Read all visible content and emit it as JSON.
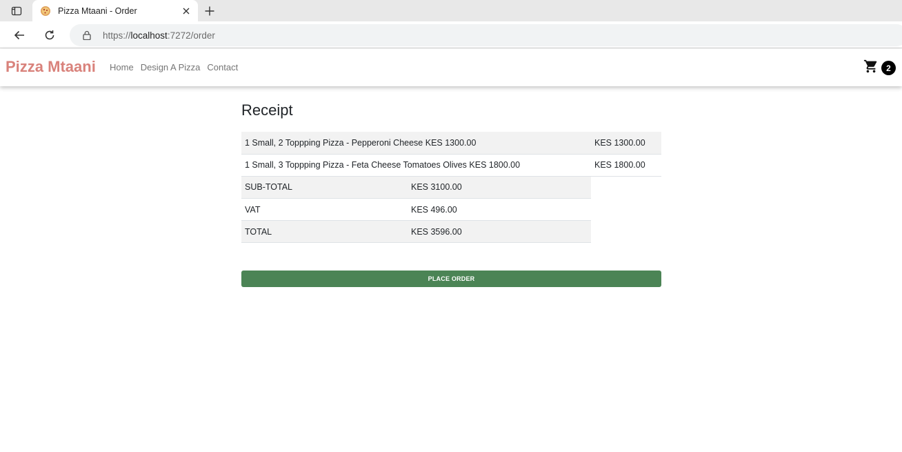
{
  "browser": {
    "tab_title": "Pizza Mtaani - Order",
    "url_scheme": "https://",
    "url_host": "localhost",
    "url_path": ":7272/order"
  },
  "site": {
    "brand": "Pizza Mtaani",
    "nav": [
      "Home",
      "Design A Pizza",
      "Contact"
    ],
    "cart_count": "2"
  },
  "receipt": {
    "title": "Receipt",
    "items": [
      {
        "description": "1 Small, 2 Toppping Pizza - Pepperoni Cheese KES 1300.00",
        "price": "KES 1300.00"
      },
      {
        "description": "1 Small, 3 Toppping Pizza - Feta Cheese Tomatoes Olives KES 1800.00",
        "price": "KES 1800.00"
      }
    ],
    "totals": [
      {
        "label": "SUB-TOTAL",
        "value": "KES 3100.00"
      },
      {
        "label": "VAT",
        "value": "KES 496.00"
      },
      {
        "label": "TOTAL",
        "value": "KES 3596.00"
      }
    ],
    "place_order_label": "PLACE ORDER",
    "place_order_color": "#4b8455"
  },
  "colors": {
    "brand": "#d9827b",
    "row_stripe": "#f2f2f2"
  }
}
